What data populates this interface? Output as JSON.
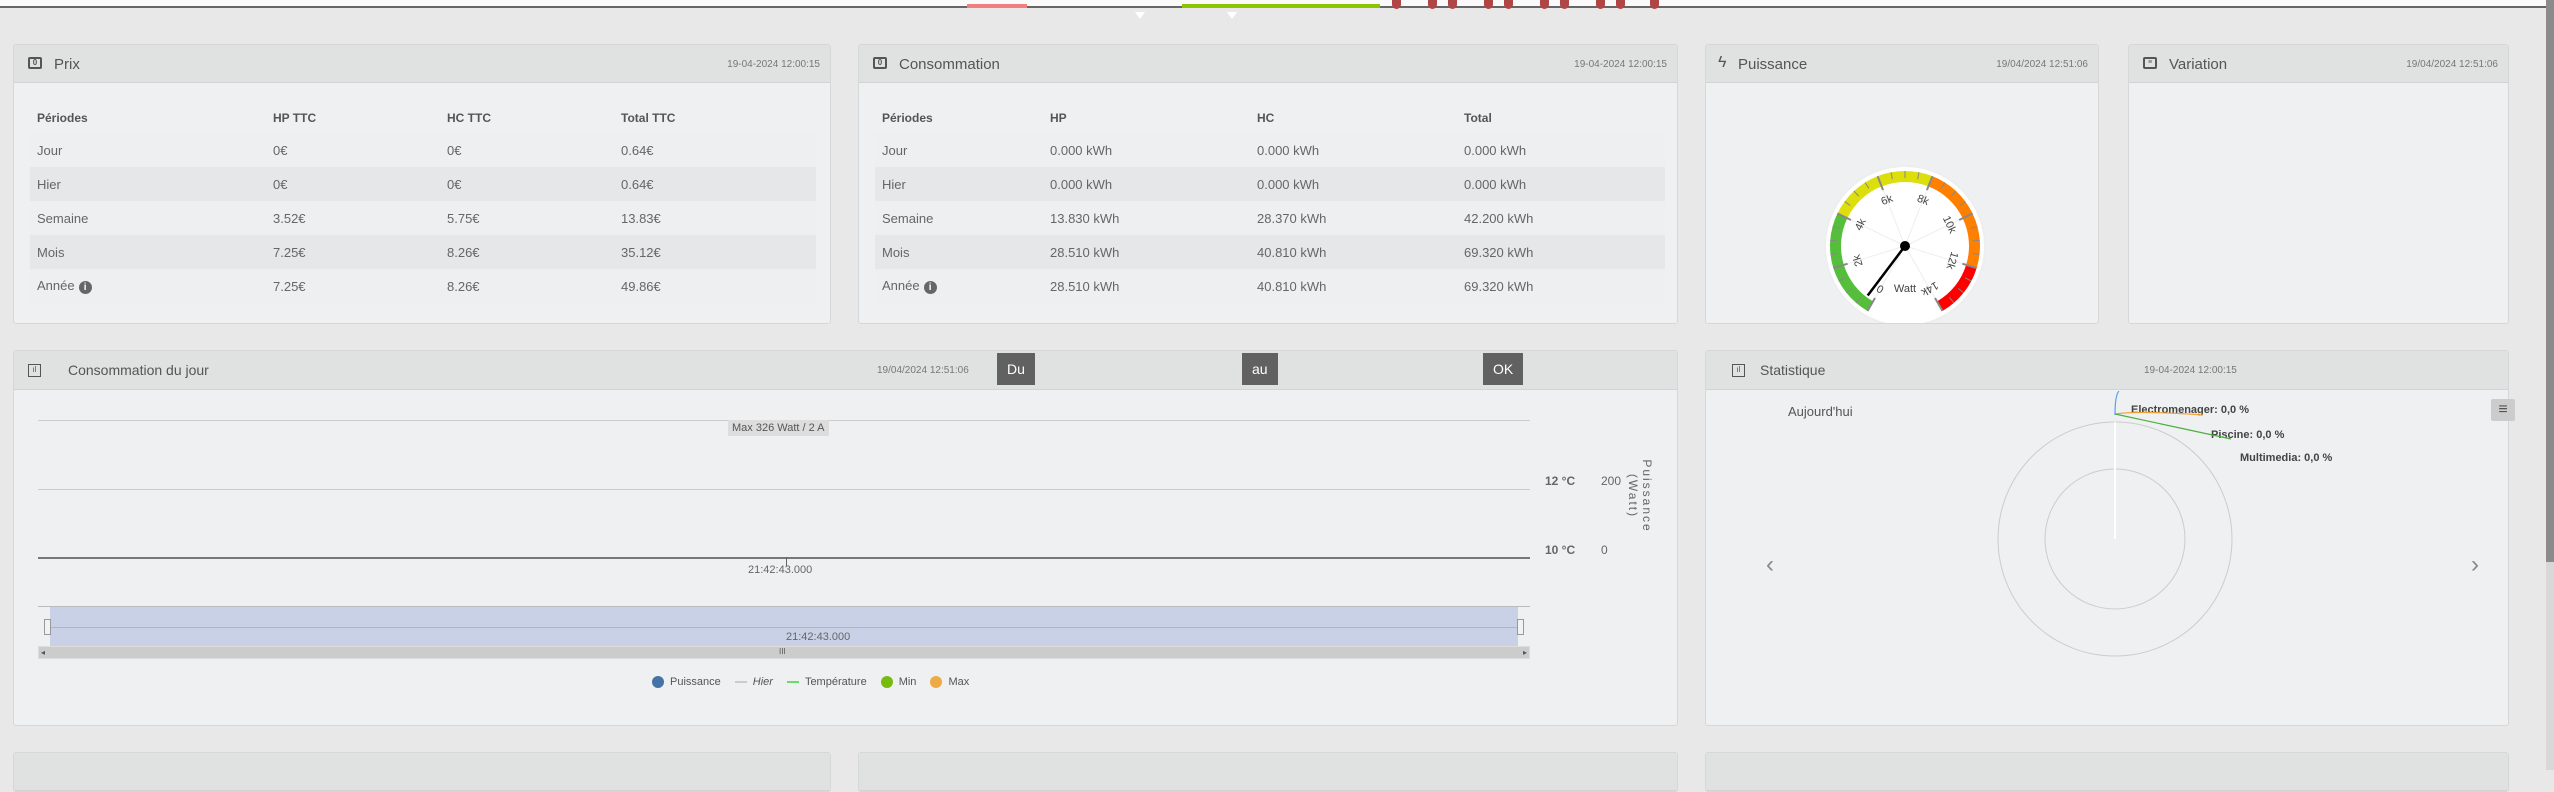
{
  "prix": {
    "title": "Prix",
    "timestamp": "19-04-2024 12:00:15",
    "headers": [
      "Périodes",
      "HP TTC",
      "HC TTC",
      "Total TTC"
    ],
    "rows": [
      [
        "Jour",
        "0€",
        "0€",
        "0.64€"
      ],
      [
        "Hier",
        "0€",
        "0€",
        "0.64€"
      ],
      [
        "Semaine",
        "3.52€",
        "5.75€",
        "13.83€"
      ],
      [
        "Mois",
        "7.25€",
        "8.26€",
        "35.12€"
      ],
      [
        "Année",
        "7.25€",
        "8.26€",
        "49.86€"
      ]
    ]
  },
  "conso": {
    "title": "Consommation",
    "timestamp": "19-04-2024 12:00:15",
    "headers": [
      "Périodes",
      "HP",
      "HC",
      "Total"
    ],
    "rows": [
      [
        "Jour",
        "0.000 kWh",
        "0.000 kWh",
        "0.000 kWh"
      ],
      [
        "Hier",
        "0.000 kWh",
        "0.000 kWh",
        "0.000 kWh"
      ],
      [
        "Semaine",
        "13.830 kWh",
        "28.370 kWh",
        "42.200 kWh"
      ],
      [
        "Mois",
        "28.510 kWh",
        "40.810 kWh",
        "69.320 kWh"
      ],
      [
        "Année",
        "28.510 kWh",
        "40.810 kWh",
        "69.320 kWh"
      ]
    ]
  },
  "puissance": {
    "title": "Puissance",
    "timestamp": "19/04/2024 12:51:06",
    "unit": "Watt",
    "value": 326,
    "min": 0,
    "max": 14000,
    "ticks": [
      "0",
      "2k",
      "4k",
      "6k",
      "8k",
      "10k",
      "12k",
      "14k"
    ],
    "bands": [
      {
        "from": 0,
        "to": 4000,
        "color": "#55bf3b"
      },
      {
        "from": 4000,
        "to": 8000,
        "color": "#dddf0d"
      },
      {
        "from": 8000,
        "to": 12000,
        "color": "#ff8000"
      },
      {
        "from": 12000,
        "to": 14000,
        "color": "#ff0000"
      }
    ]
  },
  "variation": {
    "title": "Variation",
    "timestamp": "19/04/2024 12:51:06"
  },
  "jour": {
    "title": "Consommation du jour",
    "timestamp": "19/04/2024 12:51:06",
    "btn_du": "Du",
    "btn_au": "au",
    "btn_ok": "OK",
    "max_label": "Max 326 Watt / 2 A",
    "y_temp": [
      "12 °C",
      "10 °C"
    ],
    "y_power": [
      "200",
      "0"
    ],
    "y_title": "Puissance (Watt)",
    "x_label": "21:42:43.000",
    "nav_label": "21:42:43.000",
    "nav_handle": "III",
    "legend": [
      {
        "label": "Puissance",
        "color": "#4572a7"
      },
      {
        "label": "Hier",
        "color": "#cccccc"
      },
      {
        "label": "Température",
        "color": "#66dd66"
      },
      {
        "label": "Min",
        "color": "#77bb11"
      },
      {
        "label": "Max",
        "color": "#eeaa44"
      }
    ]
  },
  "stat": {
    "title": "Statistique",
    "timestamp": "19-04-2024 12:00:15",
    "subtitle": "Aujourd'hui",
    "slices": [
      {
        "label": "Electromenager: 0,0 %",
        "color": "#5b9ee8"
      },
      {
        "label": "Piscine: 0,0 %",
        "color": "#f0a030"
      },
      {
        "label": "Multimedia: 0,0 %",
        "color": "#4caf3b"
      }
    ]
  },
  "colors": {
    "bg": "#e8e8e9",
    "panel": "#eff0f1",
    "header": "#e0e1e1",
    "button": "#616161"
  }
}
